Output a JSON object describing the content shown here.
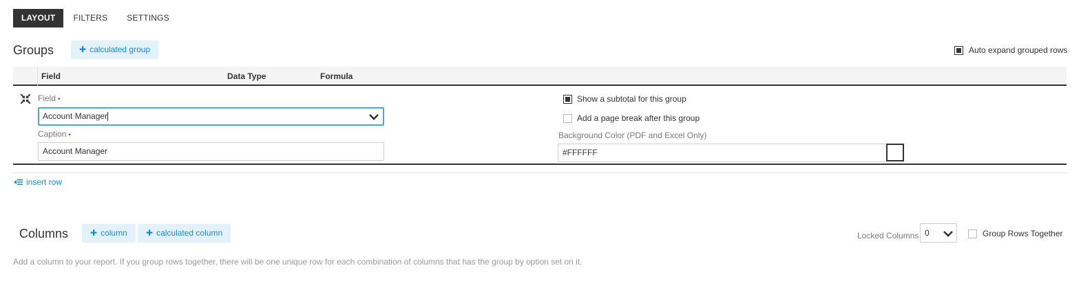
{
  "tabs": [
    {
      "label": "LAYOUT",
      "active": true
    },
    {
      "label": "FILTERS",
      "active": false
    },
    {
      "label": "SETTINGS",
      "active": false
    }
  ],
  "groups": {
    "title": "Groups",
    "add_calc_label": "calculated group",
    "auto_expand_label": "Auto expand grouped rows",
    "auto_expand_checked": true,
    "headers": {
      "field": "Field",
      "data_type": "Data Type",
      "formula": "Formula"
    },
    "row": {
      "field_label": "Field",
      "field_value": "Account Manager",
      "caption_label": "Caption",
      "caption_value": "Account Manager",
      "required_mark": "•",
      "subtotal_label": "Show a subtotal for this group",
      "subtotal_checked": true,
      "pagebreak_label": "Add a page break after this group",
      "pagebreak_checked": false,
      "bg_color_label": "Background Color (PDF and Excel Only)",
      "bg_color_value": "#FFFFFF"
    },
    "insert_row_label": "insert row"
  },
  "columns": {
    "title": "Columns",
    "add_column_label": "column",
    "add_calc_label": "calculated column",
    "locked_label": "Locked Columns",
    "locked_value": "0",
    "group_rows_label": "Group Rows Together",
    "group_rows_checked": false,
    "hint": "Add a column to your report. If you group rows together, there will be one unique row for each combination of columns that has the group by option set on it."
  },
  "colors": {
    "accent": "#1c8ac7",
    "accent_bg": "#e3f2fa",
    "focus_border": "#47aac8",
    "dark": "#333333",
    "required": "#c0392b"
  },
  "icons": {
    "collapse": "collapse-arrows-icon",
    "chevron": "chevron-down-icon",
    "plus": "plus-icon",
    "insert_row": "insert-row-icon"
  }
}
